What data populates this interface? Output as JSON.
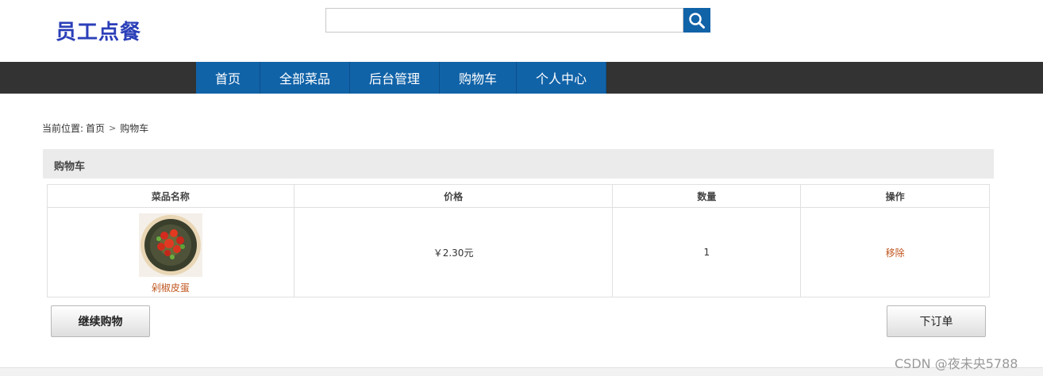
{
  "header": {
    "logo": "员工点餐",
    "search_placeholder": "",
    "search_icon": "search-icon"
  },
  "nav": [
    {
      "label": "首页"
    },
    {
      "label": "全部菜品"
    },
    {
      "label": "后台管理"
    },
    {
      "label": "购物车"
    },
    {
      "label": "个人中心"
    }
  ],
  "breadcrumb": {
    "prefix": "当前位置:",
    "home": "首页",
    "separator": ">",
    "current": "购物车"
  },
  "panel": {
    "title": "购物车"
  },
  "table": {
    "headers": [
      "菜品名称",
      "价格",
      "数量",
      "操作"
    ],
    "rows": [
      {
        "dish_name": "剁椒皮蛋",
        "price": "￥2.30元",
        "quantity": "1",
        "action": "移除"
      }
    ]
  },
  "buttons": {
    "continue": "继续购物",
    "order": "下订单"
  },
  "watermark": "CSDN @夜未央5788",
  "colors": {
    "nav_bar": "#333333",
    "nav_item": "#1163a8",
    "logo": "#2b3fb8",
    "link": "#c0561f"
  }
}
